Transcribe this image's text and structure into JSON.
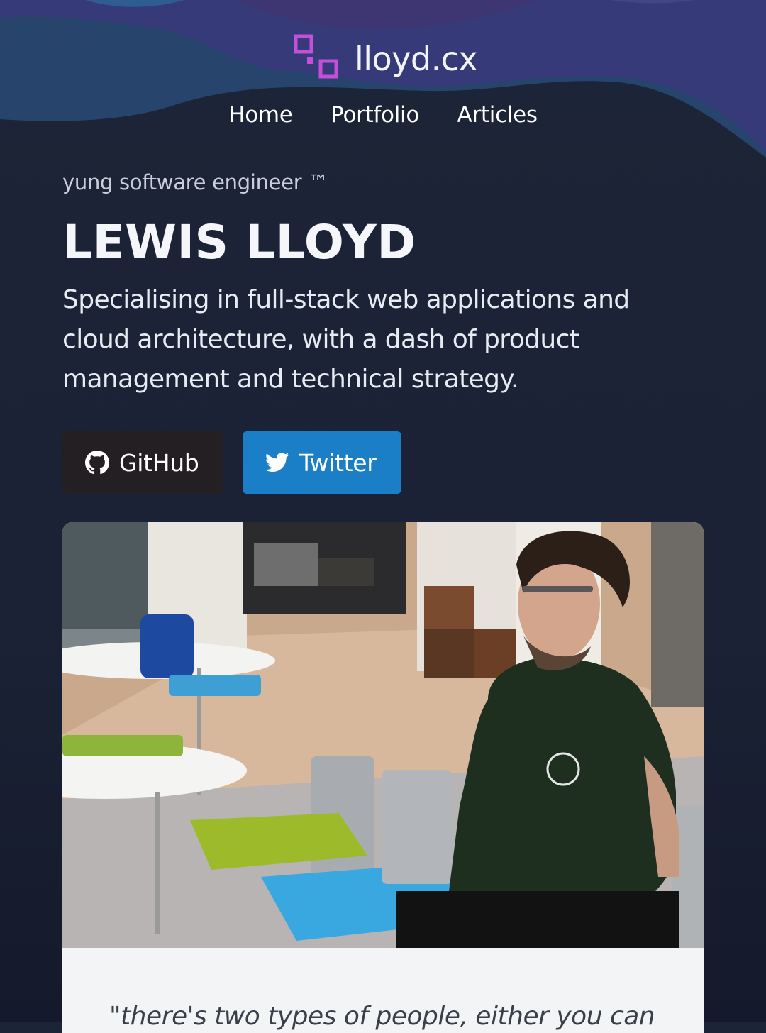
{
  "header": {
    "site_title": "lloyd.cx",
    "logo_icon": "squares-logo-icon",
    "accent_color": "#c44fd8"
  },
  "nav": {
    "items": [
      {
        "label": "Home"
      },
      {
        "label": "Portfolio"
      },
      {
        "label": "Articles"
      }
    ]
  },
  "hero": {
    "tagline": "yung software engineer ™",
    "name": "LEWIS LLOYD",
    "intro": "Specialising in full-stack web applications and cloud architecture, with a dash of product management and technical strategy."
  },
  "buttons": {
    "github": {
      "label": "GitHub",
      "icon": "github-icon",
      "color": "#231f23"
    },
    "twitter": {
      "label": "Twitter",
      "icon": "twitter-icon",
      "color": "#1b7fc7"
    }
  },
  "quote": {
    "text": "\"there's two types of people, either you can"
  }
}
